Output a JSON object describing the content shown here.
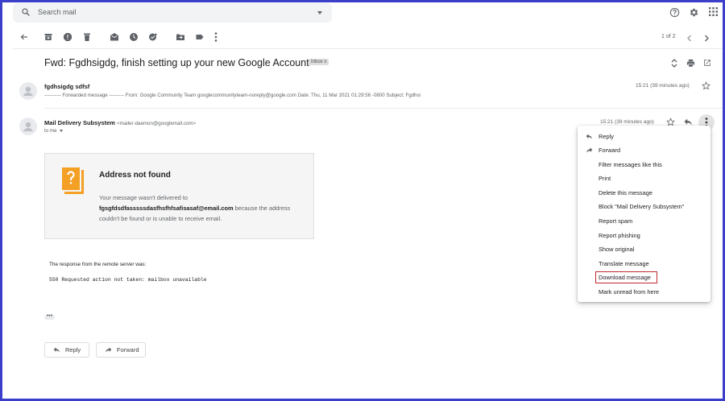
{
  "search": {
    "placeholder": "Search mail"
  },
  "pager": {
    "text": "1 of 2"
  },
  "email": {
    "subject": "Fwd: Fgdhsigdg, finish setting up your new Google Account",
    "label_chip": "Inbox",
    "label_chip_close": "x"
  },
  "message1": {
    "sender": "fgdhsigdg sdfsf",
    "snippet": "---------- Forwarded message --------- From: Google Community Team googlecommunityteam-noreply@google.com Date: Thu, 11 Mar 2021 01:29:56 -0800 Subject: Fgdhsi",
    "time": "15:21 (39 minutes ago)"
  },
  "message2": {
    "sender": "Mail Delivery Subsystem",
    "sender_email": "<mailer-daemon@googlemail.com>",
    "to": "to me",
    "time": "15:21 (39 minutes ago)"
  },
  "bounce": {
    "title": "Address not found",
    "line1": "Your message wasn't delivered to",
    "address": "fgsgfdsdfasssssdasfhsfhfsafisasaf@email.com",
    "line2": "because the address couldn't be found or is unable to receive email."
  },
  "response": {
    "intro": "The response from the remote server was:",
    "code": "550 Requested action not taken: mailbox unavailable"
  },
  "trimmed": "•••",
  "buttons": {
    "reply": "Reply",
    "forward": "Forward"
  },
  "menu": {
    "items": [
      "Reply",
      "Forward",
      "Filter messages like this",
      "Print",
      "Delete this message",
      "Block \"Mail Delivery Subsystem\"",
      "Report spam",
      "Report phishing",
      "Show original",
      "Translate message",
      "Download message",
      "Mark unread from here"
    ],
    "highlighted": "Download message"
  },
  "colors": {
    "frame": "#3c3fc9",
    "highlight": "#c0282d",
    "bounce_icon": "#f4a024"
  }
}
